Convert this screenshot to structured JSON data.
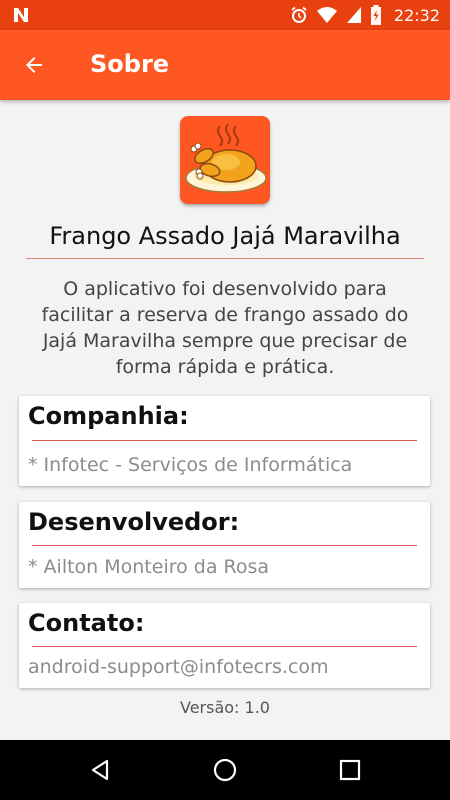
{
  "status_bar": {
    "time": "22:32",
    "icons": [
      "notification-n-icon",
      "alarm-icon",
      "wifi-icon",
      "signal-icon",
      "battery-charging-icon"
    ]
  },
  "toolbar": {
    "title": "Sobre",
    "back_icon": "arrow-back-icon"
  },
  "about": {
    "app_name": "Frango Assado Jajá Maravilha",
    "description": "O aplicativo foi desenvolvido para facilitar a reserva de frango assado do Jajá Maravilha sempre que precisar de forma rápida e prática."
  },
  "cards": [
    {
      "title": "Companhia:",
      "value": "* Infotec - Serviços de Informática"
    },
    {
      "title": "Desenvolvedor:",
      "value": "* Ailton Monteiro da Rosa"
    },
    {
      "title": "Contato:",
      "value": "android-support@infotecrs.com"
    }
  ],
  "version": "Versão: 1.0",
  "colors": {
    "status_bar": "#e8400f",
    "toolbar": "#ff5722",
    "accent_line": "#d9534f"
  }
}
